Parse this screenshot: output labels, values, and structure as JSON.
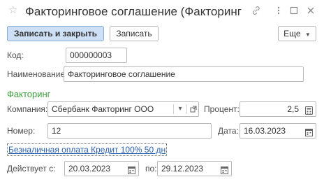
{
  "window": {
    "title": "Факторинговое соглашение (Факторинг",
    "star_icon": "star-icon",
    "link_icon": "link-icon",
    "menu_icon": "more-vertical-icon",
    "maximize_icon": "maximize-icon",
    "close_icon": "close-icon"
  },
  "toolbar": {
    "save_close_label": "Записать и закрыть",
    "save_label": "Записать",
    "more_label": "Еще",
    "more_icon": "chevron-down-icon"
  },
  "form": {
    "code_label": "Код:",
    "code_value": "000000003",
    "name_label": "Наименование:",
    "name_value": "Факторинговое соглашение",
    "section_title": "Факторинг",
    "company_label": "Компания:",
    "company_value": "Сбербанк Факторинг ООО",
    "percent_label": "Процент:",
    "percent_value": "2,5",
    "number_label": "Номер:",
    "number_value": "12",
    "date_label": "Дата:",
    "date_value": "16.03.2023",
    "payment_link": "Безналичная оплата Кредит 100% 50 дн",
    "valid_from_label": "Действует с:",
    "valid_from_value": "20.03.2023",
    "valid_to_label": "по:",
    "valid_to_value": "29.12.2023"
  },
  "colors": {
    "primary_button": "#cde0f6",
    "section_title": "#3e9b3e",
    "link": "#2a5fb0"
  }
}
